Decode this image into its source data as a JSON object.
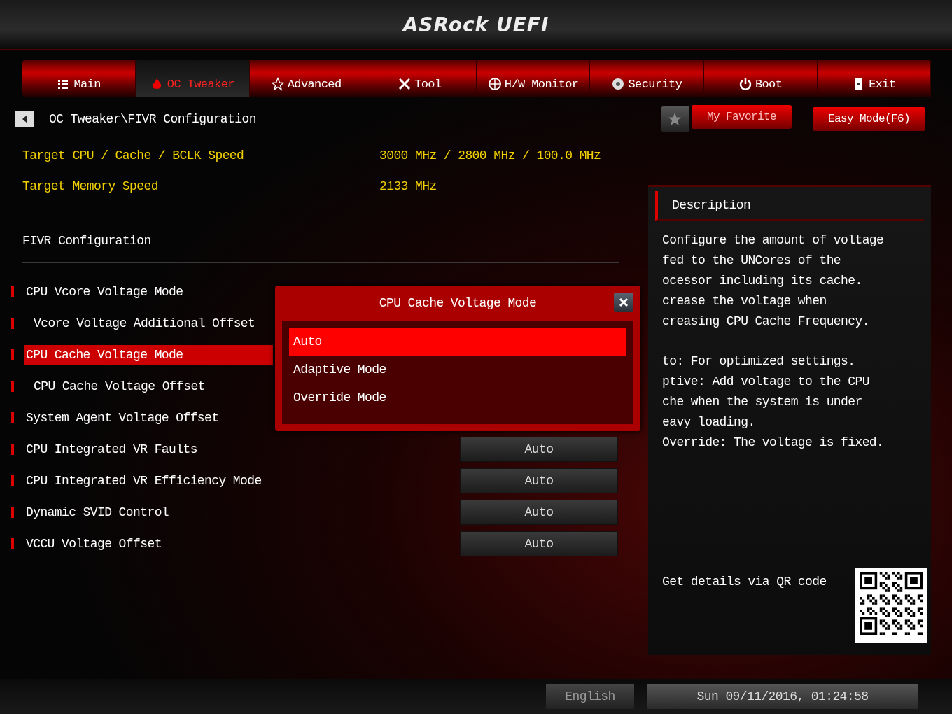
{
  "logo": "ASRock UEFI",
  "tabs": [
    {
      "label": "Main",
      "selected": false
    },
    {
      "label": "OC Tweaker",
      "selected": true
    },
    {
      "label": "Advanced",
      "selected": false
    },
    {
      "label": "Tool",
      "selected": false
    },
    {
      "label": "H/W Monitor",
      "selected": false
    },
    {
      "label": "Security",
      "selected": false
    },
    {
      "label": "Boot",
      "selected": false
    },
    {
      "label": "Exit",
      "selected": false
    }
  ],
  "breadcrumb": "OC Tweaker\\FIVR Configuration",
  "favorite_button": "My Favorite",
  "easy_mode_button": "Easy Mode(F6)",
  "info": [
    {
      "label": "Target CPU / Cache / BCLK Speed",
      "value": "3000 MHz / 2800 MHz / 100.0 MHz"
    },
    {
      "label": "Target Memory Speed",
      "value": "2133 MHz"
    }
  ],
  "section_title": "FIVR Configuration",
  "settings": [
    {
      "label": "CPU Vcore Voltage Mode",
      "selected": false,
      "children": [
        {
          "label": "Vcore Voltage Additional Offset",
          "selected": false
        }
      ]
    },
    {
      "label": "CPU Cache Voltage Mode",
      "selected": true,
      "children": [
        {
          "label": "CPU Cache Voltage Offset",
          "selected": false
        }
      ]
    },
    {
      "label": "System Agent Voltage Offset",
      "selected": false
    },
    {
      "label": "CPU Integrated VR Faults",
      "selected": false,
      "value": "Auto"
    },
    {
      "label": "CPU Integrated VR Efficiency Mode",
      "selected": false,
      "value": "Auto"
    },
    {
      "label": "Dynamic SVID Control",
      "selected": false,
      "value": "Auto"
    },
    {
      "label": "VCCU Voltage Offset",
      "selected": false,
      "value": "Auto"
    }
  ],
  "description": {
    "title": "Description",
    "paragraphs": [
      [
        "Configure the amount of voltage",
        "fed to the UNCores of the",
        "ocessor including its cache.",
        "crease the voltage when",
        "creasing CPU Cache Frequency."
      ],
      [
        "to: For optimized settings.",
        "ptive: Add voltage to the CPU",
        "che when the system is under",
        "eavy loading.",
        "Override: The voltage is fixed."
      ]
    ]
  },
  "qr_label": "Get details via QR code",
  "dialog": {
    "title": "CPU Cache Voltage Mode",
    "options": [
      {
        "label": "Auto",
        "selected": true
      },
      {
        "label": "Adaptive Mode",
        "selected": false
      },
      {
        "label": "Override Mode",
        "selected": false
      }
    ]
  },
  "footer": {
    "language": "English",
    "datetime": "Sun 09/11/2016, 01:24:58"
  }
}
